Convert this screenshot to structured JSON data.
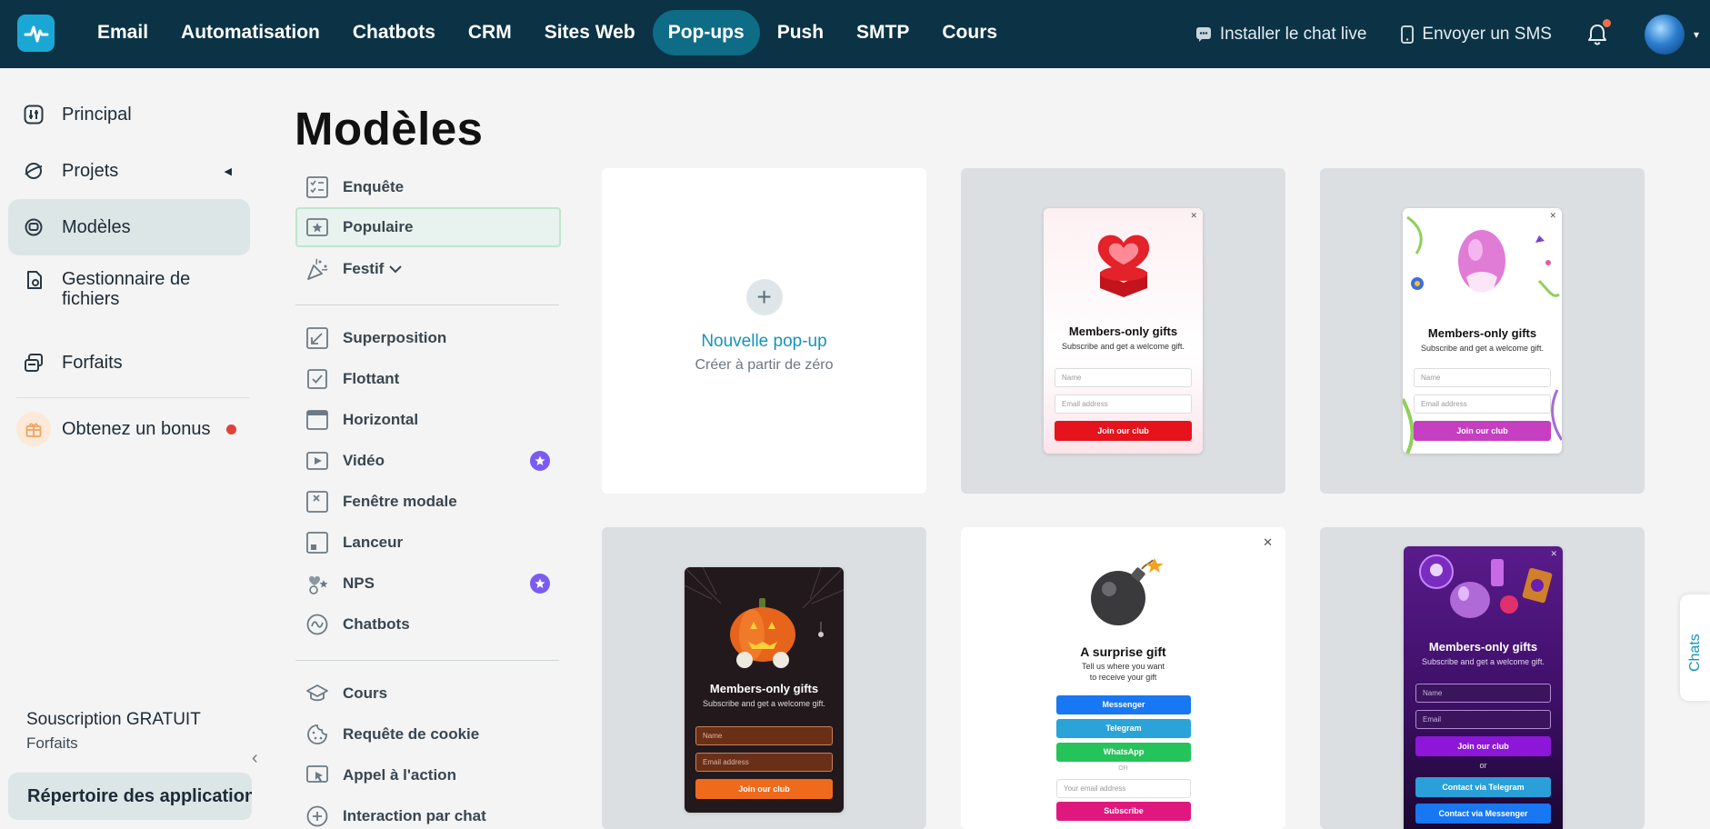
{
  "nav": {
    "items": [
      {
        "label": "Email"
      },
      {
        "label": "Automatisation"
      },
      {
        "label": "Chatbots"
      },
      {
        "label": "CRM"
      },
      {
        "label": "Sites Web"
      },
      {
        "label": "Pop-ups",
        "active": true
      },
      {
        "label": "Push"
      },
      {
        "label": "SMTP"
      },
      {
        "label": "Cours"
      }
    ],
    "install_chat": "Installer le chat live",
    "send_sms": "Envoyer un SMS"
  },
  "sidebar": {
    "items": [
      {
        "label": "Principal",
        "icon": "sliders-icon"
      },
      {
        "label": "Projets",
        "icon": "planet-icon"
      },
      {
        "label": "Modèles",
        "icon": "templates-icon"
      },
      {
        "label": "Gestionnaire de fichiers",
        "icon": "file-manager-icon"
      },
      {
        "label": "Forfaits",
        "icon": "layers-icon"
      }
    ],
    "bonus": "Obtenez un bonus",
    "subscription_title": "Souscription GRATUIT",
    "subscription_link": "Forfaits",
    "app_directory": "Répertoire des applications"
  },
  "page": {
    "title": "Modèles"
  },
  "categories": {
    "group1": [
      "Enquête",
      "Populaire",
      "Festif"
    ],
    "group2": [
      "Superposition",
      "Flottant",
      "Horizontal",
      "Vidéo",
      "Fenêtre modale",
      "Lanceur",
      "NPS",
      "Chatbots"
    ],
    "group3": [
      "Cours",
      "Requête de cookie",
      "Appel à l'action",
      "Interaction par chat"
    ]
  },
  "new_popup": {
    "title": "Nouvelle pop-up",
    "subtitle": "Créer à partir de zéro"
  },
  "templates": {
    "valentine": {
      "title": "Members-only gifts",
      "subtitle": "Subscribe and get a welcome gift.",
      "name_ph": "Name",
      "email_ph": "Email address",
      "button": "Join our club"
    },
    "easter": {
      "title": "Members-only gifts",
      "subtitle": "Subscribe and get a welcome gift.",
      "name_ph": "Name",
      "email_ph": "Email address",
      "button": "Join our club"
    },
    "halloween": {
      "title": "Members-only gifts",
      "subtitle": "Subscribe and get a welcome gift.",
      "name_ph": "Name",
      "email_ph": "Email address",
      "button": "Join our club"
    },
    "surprise": {
      "title": "A surprise gift",
      "subtitle_1": "Tell us where you want",
      "subtitle_2": "to receive your gift",
      "messenger": "Messenger",
      "telegram": "Telegram",
      "whatsapp": "WhatsApp",
      "or": "OR",
      "email_ph": "Your email address",
      "button": "Subscribe"
    },
    "magic": {
      "title": "Members-only gifts",
      "subtitle": "Subscribe and get a welcome gift.",
      "name_ph": "Name",
      "email_ph": "Email",
      "button": "Join our club",
      "or": "or",
      "telegram": "Contact via Telegram",
      "messenger": "Contact via Messenger"
    }
  },
  "chats_tab": "Chats",
  "colors": {
    "topbar": "#0b3345",
    "accent": "#1594b9",
    "active_nav": "#0f6c86"
  }
}
